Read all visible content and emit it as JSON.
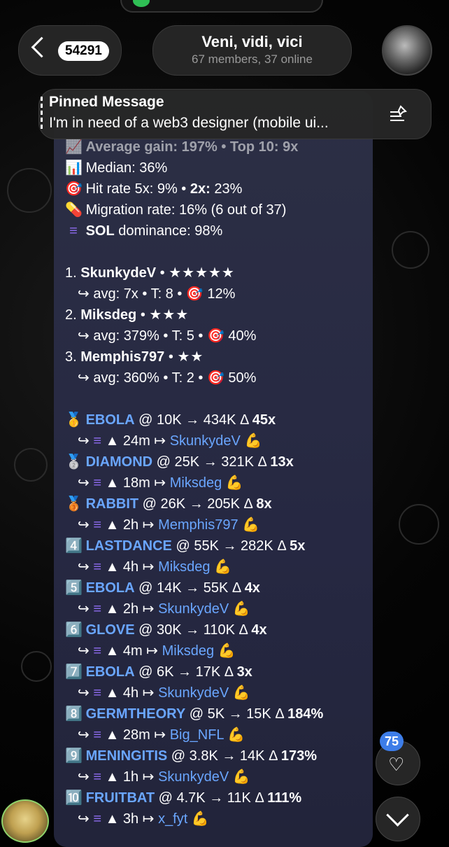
{
  "header": {
    "unread_count": "54291",
    "chat_title": "Veni, vidi, vici",
    "chat_subtitle": "67 members, 37 online"
  },
  "pinned": {
    "title": "Pinned Message",
    "text": "I'm in need of a web3 designer (mobile ui..."
  },
  "stats": {
    "avg_partial": "Average gain: 197% • Top 10: 9x",
    "median_label": "Median:",
    "median_value": "36%",
    "hit_label": "Hit rate 5x:",
    "hit_value": "9%",
    "hit_sep": "•",
    "hit2_label": "2x:",
    "hit2_value": "23%",
    "migration_label": "Migration rate:",
    "migration_value": "16%",
    "migration_detail": "(6 out of 37)",
    "sol_label": "SOL",
    "sol_rest": "dominance:",
    "sol_value": "98%"
  },
  "leaders": [
    {
      "rank": "1.",
      "name": "SkunkydeV",
      "stars": "★★★★★",
      "detail": "avg: 7x • T: 8 • ",
      "rate": "12%"
    },
    {
      "rank": "2.",
      "name": "Miksdeg",
      "stars": "★★★",
      "detail": "avg: 379% • T: 5 • ",
      "rate": "40%"
    },
    {
      "rank": "3.",
      "name": "Memphis797",
      "stars": "★★",
      "detail": "avg: 360% • T: 2 • ",
      "rate": "50%"
    }
  ],
  "calls": [
    {
      "badge": "🥇",
      "token": "EBOLA",
      "from": "@ 10K",
      "to": "→ 434K",
      "delta_symbol": "Δ",
      "delta": "45x",
      "time": "▲ 24m",
      "arrow": "↦",
      "user": "SkunkydeV"
    },
    {
      "badge": "🥈",
      "token": "DIAMOND",
      "from": "@ 25K",
      "to": "→ 321K",
      "delta_symbol": "Δ",
      "delta": "13x",
      "time": "▲ 18m",
      "arrow": "↦",
      "user": "Miksdeg"
    },
    {
      "badge": "🥉",
      "token": "RABBIT",
      "from": "@ 26K",
      "to": "→ 205K",
      "delta_symbol": "Δ",
      "delta": "8x",
      "time": "▲ 2h",
      "arrow": "↦",
      "user": "Memphis797"
    },
    {
      "badge": "4️⃣",
      "token": "LASTDANCE",
      "from": "@ 55K",
      "to": "→ 282K",
      "delta_symbol": "Δ",
      "delta": "5x",
      "time": "▲ 4h",
      "arrow": "↦",
      "user": "Miksdeg"
    },
    {
      "badge": "5️⃣",
      "token": "EBOLA",
      "from": "@ 14K",
      "to": "→ 55K",
      "delta_symbol": "Δ",
      "delta": "4x",
      "time": "▲ 2h",
      "arrow": "↦",
      "user": "SkunkydeV"
    },
    {
      "badge": "6️⃣",
      "token": "GLOVE",
      "from": "@ 30K",
      "to": "→ 110K",
      "delta_symbol": "Δ",
      "delta": "4x",
      "time": "▲ 4m",
      "arrow": "↦",
      "user": "Miksdeg"
    },
    {
      "badge": "7️⃣",
      "token": "EBOLA",
      "from": "@ 6K",
      "to": "→ 17K",
      "delta_symbol": "Δ",
      "delta": "3x",
      "time": "▲ 4h",
      "arrow": "↦",
      "user": "SkunkydeV"
    },
    {
      "badge": "8️⃣",
      "token": "GERMTHEORY",
      "from": "@ 5K",
      "to": "→ 15K",
      "delta_symbol": "Δ",
      "delta": "184%",
      "time": "▲ 28m",
      "arrow": "↦",
      "user": "Big_NFL"
    },
    {
      "badge": "9️⃣",
      "token": "MENINGITIS",
      "from": "@ 3.8K",
      "to": "→ 14K",
      "delta_symbol": "Δ",
      "delta": "173%",
      "time": "▲ 1h",
      "arrow": "↦",
      "user": "SkunkydeV"
    },
    {
      "badge": "🔟",
      "token": "FRUITBAT",
      "from": "@ 4.7K",
      "to": "→ 11K",
      "delta_symbol": "Δ",
      "delta": "111%",
      "time": "▲ 3h",
      "arrow": "↦",
      "user": "x_fyt"
    }
  ],
  "reaction_count": "75",
  "icons": {
    "muscle": "💪",
    "target": "🎯",
    "sol": "≡",
    "reply_arrow": "↪"
  },
  "colors": {
    "link": "#6aa6ff",
    "badge": "#3d7de8",
    "bubble": "#2c2f45"
  }
}
